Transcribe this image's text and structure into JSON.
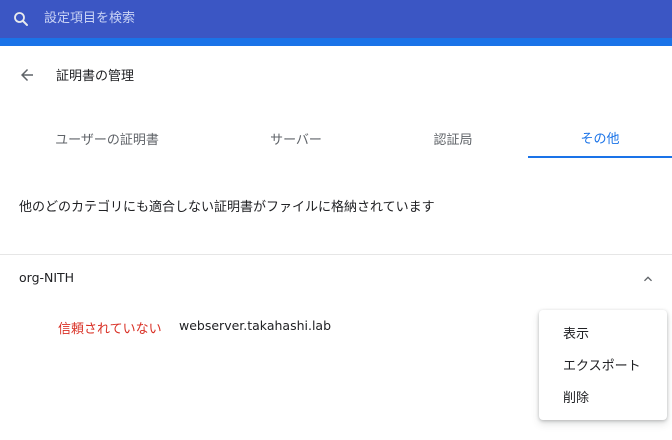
{
  "search": {
    "placeholder": "設定項目を検索"
  },
  "header": {
    "title": "証明書の管理"
  },
  "tabs": [
    {
      "label": "ユーザーの証明書",
      "active": false
    },
    {
      "label": "サーバー",
      "active": false
    },
    {
      "label": "認証局",
      "active": false
    },
    {
      "label": "その他",
      "active": true
    }
  ],
  "description": "他のどのカテゴリにも適合しない証明書がファイルに格納されています",
  "group": {
    "name": "org-NITH",
    "certificate": {
      "status": "信頼されていない",
      "name": "webserver.takahashi.lab"
    }
  },
  "menu": {
    "items": [
      {
        "label": "表示"
      },
      {
        "label": "エクスポート"
      },
      {
        "label": "削除"
      }
    ]
  },
  "colors": {
    "accent": "#1a73e8",
    "header_bar": "#3b56c4",
    "untrusted": "#d93025"
  },
  "icons": [
    "search-icon",
    "back-arrow-icon",
    "chevron-up-icon"
  ]
}
